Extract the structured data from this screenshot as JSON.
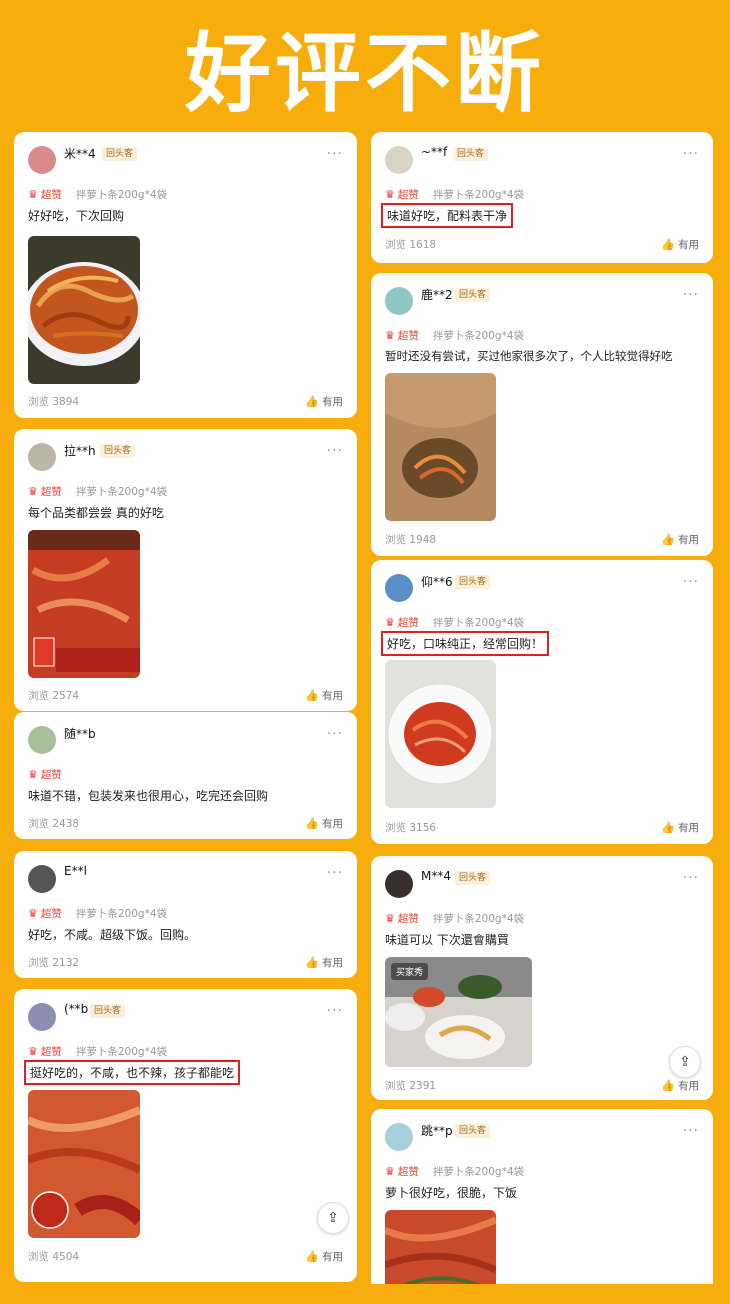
{
  "title": "好评不断",
  "common": {
    "more": "···",
    "helpful": "有用",
    "rating": "超赞",
    "return_badge": "回头客",
    "crown": "♛",
    "thumb": "👍",
    "back_to_top": "⇪"
  },
  "left": [
    {
      "user": "米**4",
      "spec": "拌萝卜条200g*4袋",
      "text": "好好吃，下次回购",
      "views": "浏览 3894",
      "badge": true
    },
    {
      "user": "拉**h",
      "spec": "拌萝卜条200g*4袋",
      "text": "每个品类都尝尝 真的好吃",
      "views": "浏览 2574",
      "badge": true
    },
    {
      "user": "随**b",
      "spec": "",
      "text": "味道不错，包装发来也很用心，吃完还会回购",
      "views": "浏览 2438",
      "badge": false
    },
    {
      "user": "E**l",
      "spec": "拌萝卜条200g*4袋",
      "text": "好吃，不咸。超级下饭。回购。",
      "views": "浏览 2132",
      "badge": false
    },
    {
      "user": "(**b",
      "spec": "拌萝卜条200g*4袋",
      "text": "挺好吃的，不咸，也不辣，孩子都能吃",
      "views": "浏览 4504",
      "badge": true
    }
  ],
  "right": [
    {
      "user": "~**f",
      "spec": "拌萝卜条200g*4袋",
      "text": "味道好吃，配料表干净",
      "views": "浏览 1618",
      "badge": true
    },
    {
      "user": "鹿**2",
      "spec": "拌萝卜条200g*4袋",
      "text": "暂时还没有尝试，买过他家很多次了，个人比较觉得好吃",
      "views": "浏览 1948",
      "badge": true
    },
    {
      "user": "仰**6",
      "spec": "拌萝卜条200g*4袋",
      "text": "好吃，口味纯正，经常回购！",
      "views": "浏览 3156",
      "badge": true
    },
    {
      "user": "M**4",
      "spec": "拌萝卜条200g*4袋",
      "text": "味道可以 下次還會購買",
      "views": "浏览 2391",
      "badge": true,
      "photo_tag": "买家秀"
    },
    {
      "user": "跳**p",
      "spec": "拌萝卜条200g*4袋",
      "text": "萝卜很好吃，很脆，下饭",
      "views": "",
      "badge": true
    }
  ],
  "colors": {
    "background": "#f7ae0c",
    "highlight": "#e0201f",
    "rating": "#e8452c"
  }
}
